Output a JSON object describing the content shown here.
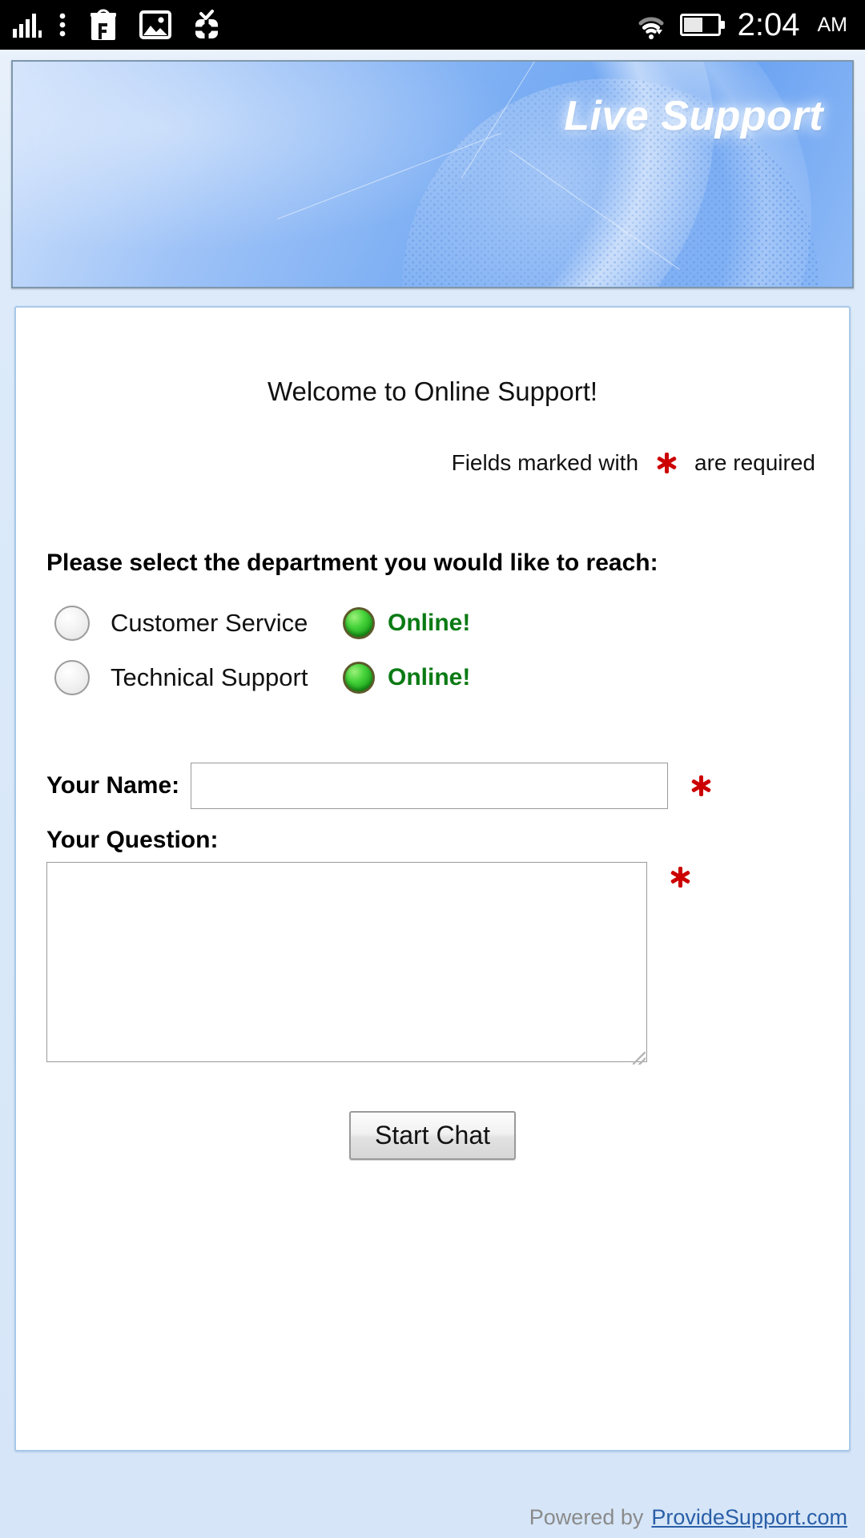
{
  "statusbar": {
    "time": "2:04",
    "ampm": "AM",
    "left_icons": [
      "signal-bars-icon",
      "overflow-menu-icon",
      "flipkart-shopping-bag-icon",
      "gallery-image-icon",
      "app-update-check-icon"
    ],
    "right_icons": [
      "wifi-icon",
      "battery-icon"
    ],
    "battery_level_percent": 55,
    "signal_label": "1"
  },
  "banner": {
    "title": "Live Support"
  },
  "panel": {
    "welcome": "Welcome to Online Support!",
    "required_note_prefix": "Fields marked with",
    "required_note_suffix": "are required",
    "department_heading": "Please select the department you would like to reach:",
    "departments": [
      {
        "name": "Customer Service",
        "status": "Online!",
        "selected": false
      },
      {
        "name": "Technical Support",
        "status": "Online!",
        "selected": false
      }
    ],
    "name_label": "Your Name:",
    "name_value": "",
    "name_placeholder": "",
    "question_label": "Your Question:",
    "question_value": "",
    "question_placeholder": "",
    "submit_label": "Start Chat"
  },
  "footer": {
    "powered_by": "Powered by",
    "link_text": "ProvideSupport.com"
  },
  "colors": {
    "required_asterisk": "#cc0000",
    "online_text": "#0a7a14",
    "online_orb": "#2fbd2a",
    "banner_blue": "#6ba3f2",
    "panel_border": "#a8c8ea",
    "page_bg": "#d6e6f8",
    "footer_link": "#2a5fa8"
  }
}
